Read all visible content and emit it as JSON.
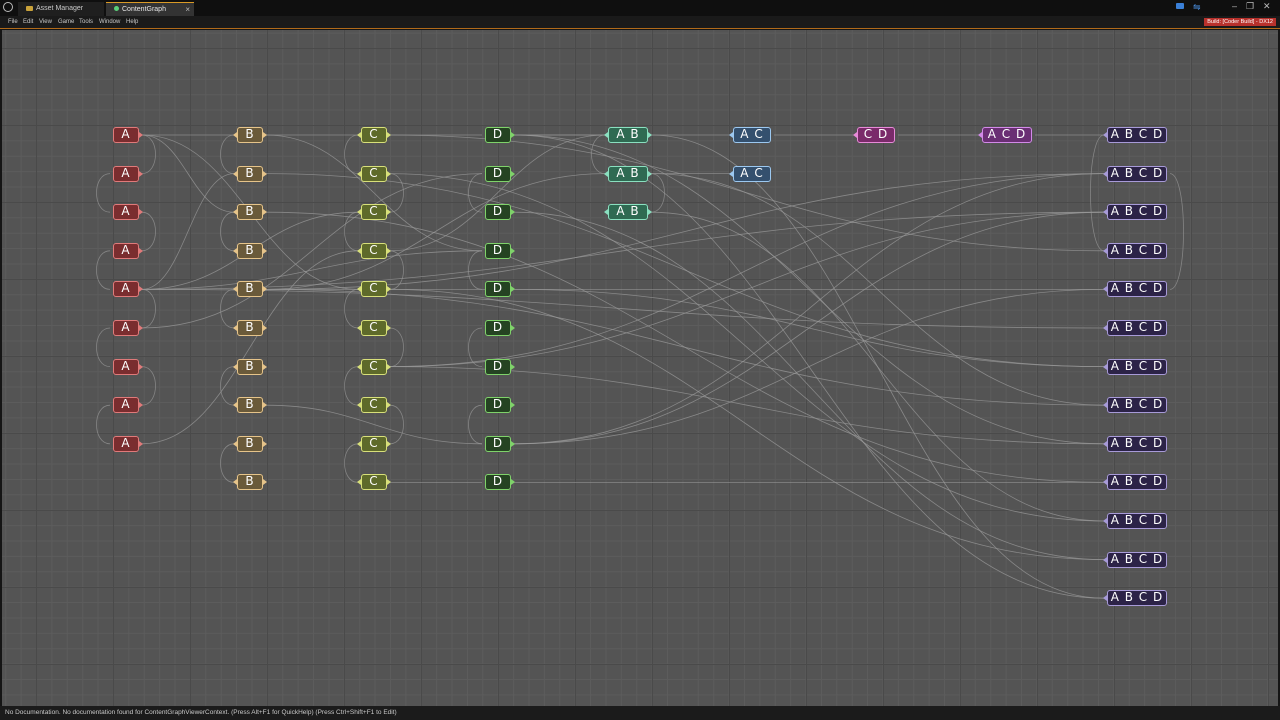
{
  "titlebar": {
    "tabs": [
      {
        "label": "Asset Manager",
        "icon": "folder-icon"
      },
      {
        "label": "ContentGraph",
        "icon": "graph-icon",
        "close": "×"
      }
    ],
    "window_controls": {
      "minimize": "–",
      "maximize": "❐",
      "close": "✕"
    }
  },
  "menu": {
    "items": [
      "File",
      "Edit",
      "View",
      "Game",
      "Tools",
      "Window",
      "Help"
    ],
    "build_badge": "Build: [Coder Build] - DX12"
  },
  "colors": {
    "A": {
      "bg": "#7a2d2f",
      "border": "#e07a7a"
    },
    "B": {
      "bg": "#6a5a3a",
      "border": "#e6c48a"
    },
    "C": {
      "bg": "#5e6a2a",
      "border": "#d8e07a"
    },
    "D": {
      "bg": "#254322",
      "border": "#7fd36a"
    },
    "AB": {
      "bg": "#2f6a52",
      "border": "#8ae0c0"
    },
    "AC": {
      "bg": "#34506e",
      "border": "#9cc8f0"
    },
    "CD": {
      "bg": "#7a2a6a",
      "border": "#e78ad8"
    },
    "ACD": {
      "bg": "#6a2f74",
      "border": "#d28ae8"
    },
    "ABCD": {
      "bg": "#2c2347",
      "border": "#a79ad8"
    }
  },
  "nodes": {
    "col_A": [
      "A",
      "A",
      "A",
      "A",
      "A",
      "A",
      "A",
      "A",
      "A"
    ],
    "col_B": [
      "B",
      "B",
      "B",
      "B",
      "B",
      "B",
      "B",
      "B",
      "B",
      "B"
    ],
    "col_C": [
      "C",
      "C",
      "C",
      "C",
      "C",
      "C",
      "C",
      "C",
      "C",
      "C"
    ],
    "col_D": [
      "D",
      "D",
      "D",
      "D",
      "D",
      "D",
      "D",
      "D",
      "D",
      "D"
    ],
    "col_AB": [
      "A B",
      "A B",
      "A B"
    ],
    "col_AC": [
      "A C",
      "A C"
    ],
    "col_CD": [
      "C D"
    ],
    "col_ACD": [
      "A C D"
    ],
    "col_ABCD": [
      "A B C D",
      "A B C D",
      "A B C D",
      "A B C D",
      "A B C D",
      "A B C D",
      "A B C D",
      "A B C D",
      "A B C D",
      "A B C D",
      "A B C D",
      "A B C D",
      "A B C D"
    ]
  },
  "status": {
    "text": "No Documentation. No documentation found for ContentGraphViewerContext. (Press Alt+F1 for QuickHelp) (Press Ctrl+Shift+F1 to Edit)"
  }
}
